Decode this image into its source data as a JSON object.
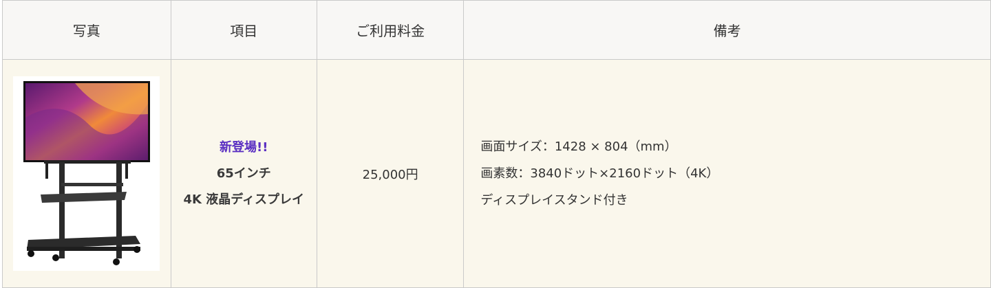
{
  "table": {
    "headers": [
      "写真",
      "項目",
      "ご利用料金",
      "備考"
    ],
    "row": {
      "photo_alt": "65インチ 4K液晶ディスプレイ スタンド付き",
      "badge": "新登場!!",
      "item_lines": [
        "65インチ",
        "4K 液晶ディスプレイ"
      ],
      "price": "25,000円",
      "notes": [
        "画面サイズ：1428 × 804（mm）",
        "画素数：3840ドット×2160ドット（4K）",
        "ディスプレイスタンド付き"
      ]
    }
  },
  "colors": {
    "header_bg": "#f8f7f5",
    "row_bg": "#faf7ec",
    "badge": "#5a2fc2",
    "border": "#c9c9c9"
  },
  "icons": [
    "tv-on-stand-image"
  ]
}
